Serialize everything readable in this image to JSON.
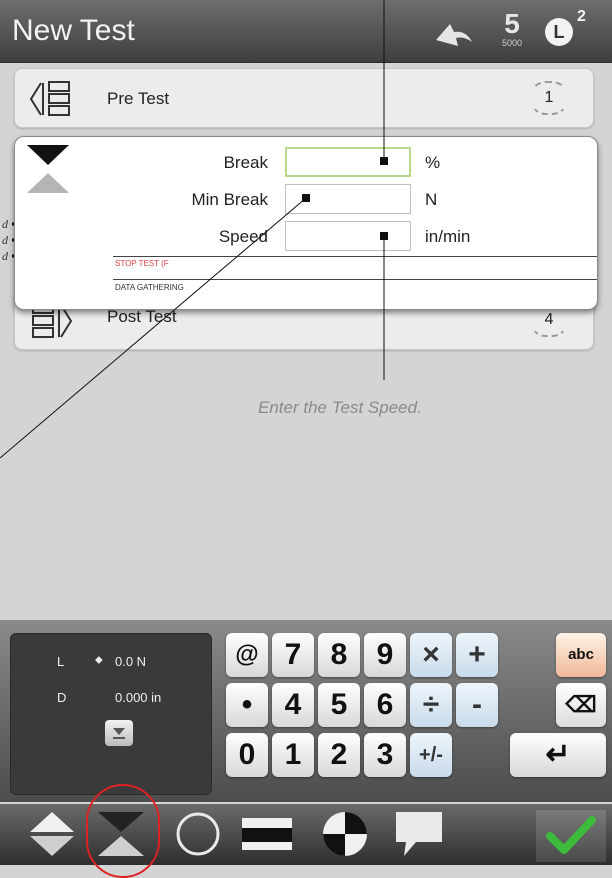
{
  "header": {
    "title": "New Test",
    "load_cell_value": "5",
    "load_cell_capacity": "5000",
    "user_badge": "L",
    "user_number": "2"
  },
  "stages": [
    {
      "label": "Pre Test",
      "number": "1"
    },
    {
      "label": "Post Test",
      "number": "4"
    }
  ],
  "break_panel": {
    "fields": [
      {
        "label": "Break",
        "value": "",
        "unit": "%"
      },
      {
        "label": "Min Break",
        "value": "",
        "unit": "N"
      },
      {
        "label": "Speed",
        "value": "",
        "unit": "in/min"
      }
    ],
    "stop_test": "STOP TEST (F",
    "data_gathering": "DATA GATHERING"
  },
  "data_stage_partial_label": "D",
  "caption": "Enter the Test Speed.",
  "readout": {
    "load_label": "L",
    "load_value": "0.0 N",
    "disp_label": "D",
    "disp_value": "0.000 in"
  },
  "keypad": {
    "row1": [
      "@",
      "7",
      "8",
      "9",
      "×",
      "+",
      "abc"
    ],
    "row2": [
      "•",
      "4",
      "5",
      "6",
      "÷",
      "-",
      "⌫"
    ],
    "row3": [
      "0",
      "1",
      "2",
      "3",
      "+/-",
      "↵"
    ]
  },
  "bottom_icons": [
    "compression-icon",
    "break-icon",
    "cycle-icon",
    "hold-icon",
    "target-icon",
    "comment-icon",
    "confirm-check-icon"
  ],
  "colors": {
    "accent_red": "#d22222",
    "confirm_green": "#3dbb3d",
    "active_field": "#b8d98a"
  }
}
